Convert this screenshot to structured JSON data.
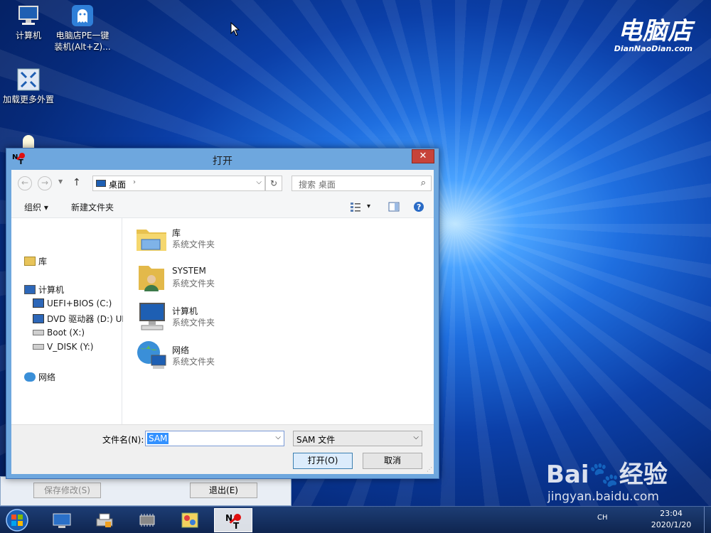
{
  "desktop": {
    "icons": [
      {
        "label": "计算机"
      },
      {
        "label": "电脑店PE一键装机(Alt+Z)..."
      },
      {
        "label": "加载更多外置"
      }
    ],
    "brand": {
      "title": "电脑店",
      "subtitle": "DianNaoDian.com"
    }
  },
  "background_window": {
    "save_label": "保存修改(S)",
    "exit_label": "退出(E)"
  },
  "dialog": {
    "title": "打开",
    "close_glyph": "✕",
    "address": {
      "location": "桌面",
      "chevron": "›"
    },
    "search": {
      "placeholder": "搜索 桌面"
    },
    "toolbar": {
      "organize": "组织 ▾",
      "new_folder": "新建文件夹",
      "view_arrow": "▾"
    },
    "nav": [
      {
        "label": "库"
      },
      {
        "label": "计算机"
      },
      {
        "label": "UEFI+BIOS (C:)"
      },
      {
        "label": "DVD 驱动器 (D:) UE"
      },
      {
        "label": "Boot (X:)"
      },
      {
        "label": "V_DISK (Y:)"
      },
      {
        "label": "网络"
      }
    ],
    "items": [
      {
        "name": "库",
        "type": "系统文件夹",
        "icon": "library-folder-icon"
      },
      {
        "name": "SYSTEM",
        "type": "系统文件夹",
        "icon": "user-folder-icon"
      },
      {
        "name": "计算机",
        "type": "系统文件夹",
        "icon": "computer-icon"
      },
      {
        "name": "网络",
        "type": "系统文件夹",
        "icon": "network-icon"
      }
    ],
    "filename_label": "文件名(N):",
    "filename_value": "SAM",
    "filetype_value": "SAM 文件",
    "open_label": "打开(O)",
    "cancel_label": "取消"
  },
  "taskbar": {
    "lang": "CH",
    "time": "23:04",
    "date": "2020/1/20"
  },
  "watermark": {
    "line1": "Bai🐾经验",
    "line2": "jingyan.baidu.com"
  },
  "colors": {
    "accent": "#3391ff",
    "close": "#c7433a",
    "dialog_frame": "#6ea7de"
  }
}
